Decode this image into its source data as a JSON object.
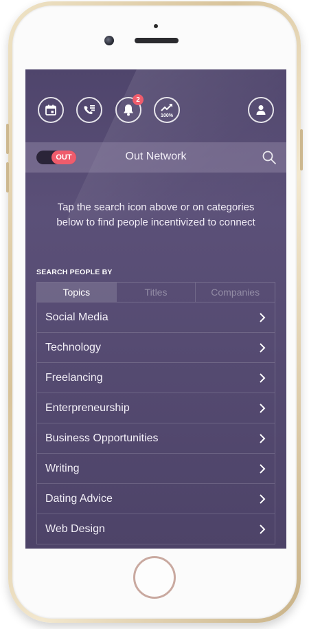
{
  "topbar": {
    "icons": [
      "calendar-icon",
      "phone-list-icon",
      "bell-icon",
      "trending-up-icon",
      "profile-icon"
    ],
    "notification_count": "2",
    "growth_label": "100%"
  },
  "network": {
    "toggle_label": "OUT",
    "title": "Out Network"
  },
  "intro_text": "Tap the search icon above or on categories below to find people incentivized to connect",
  "search_section": {
    "label": "SEARCH PEOPLE BY",
    "tabs": [
      {
        "label": "Topics",
        "active": true
      },
      {
        "label": "Titles",
        "active": false
      },
      {
        "label": "Companies",
        "active": false
      }
    ]
  },
  "topics": [
    {
      "label": "Social Media"
    },
    {
      "label": "Technology"
    },
    {
      "label": "Freelancing"
    },
    {
      "label": "Enterpreneurship"
    },
    {
      "label": "Business Opportunities"
    },
    {
      "label": "Writing"
    },
    {
      "label": "Dating Advice"
    },
    {
      "label": "Web Design"
    }
  ],
  "colors": {
    "accent": "#ef5c6c",
    "screen_bg": "#544a72"
  }
}
